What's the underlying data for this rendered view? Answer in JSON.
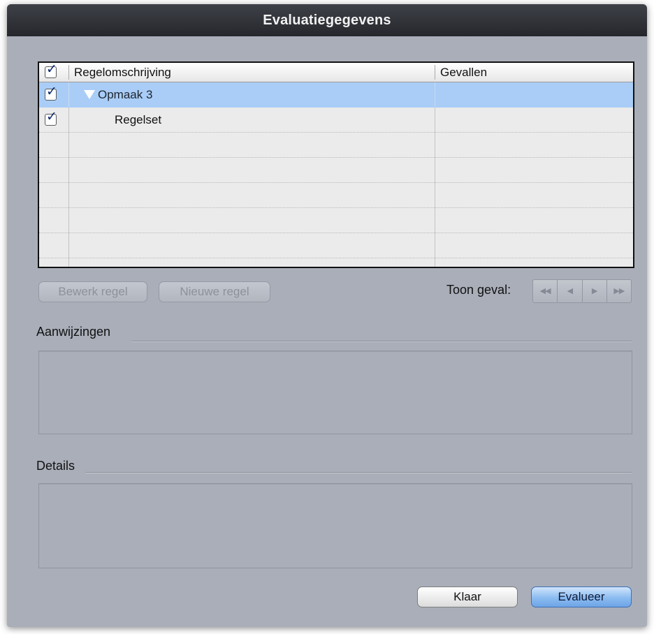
{
  "window": {
    "title": "Evaluatiegegevens"
  },
  "table": {
    "columns": [
      "Regelomschrijving",
      "Gevallen"
    ],
    "rows": [
      {
        "checked": true,
        "label": "Opmaak 3",
        "gevallen": "",
        "expanded": true,
        "selected": true
      },
      {
        "checked": true,
        "label": "Regelset",
        "gevallen": "",
        "expanded": false,
        "selected": false
      }
    ],
    "check_glyph": "✓"
  },
  "buttons": {
    "edit_rule": "Bewerk regel",
    "new_rule": "Nieuwe regel",
    "done": "Klaar",
    "evaluate": "Evalueer"
  },
  "navigation": {
    "label": "Toon geval:",
    "first": "◀◀",
    "prev": "◀",
    "next": "▶",
    "last": "▶▶"
  },
  "sections": {
    "hints_label": "Aanwijzingen",
    "details_label": "Details"
  },
  "icons": [
    "disclosure-triangle-icon",
    "checkbox-icon",
    "first-icon",
    "previous-icon",
    "next-icon",
    "last-icon"
  ],
  "colors": {
    "selection": "#a9cdf7",
    "window_bg": "#a9aeb9",
    "default_button": "#8bbbf1"
  }
}
